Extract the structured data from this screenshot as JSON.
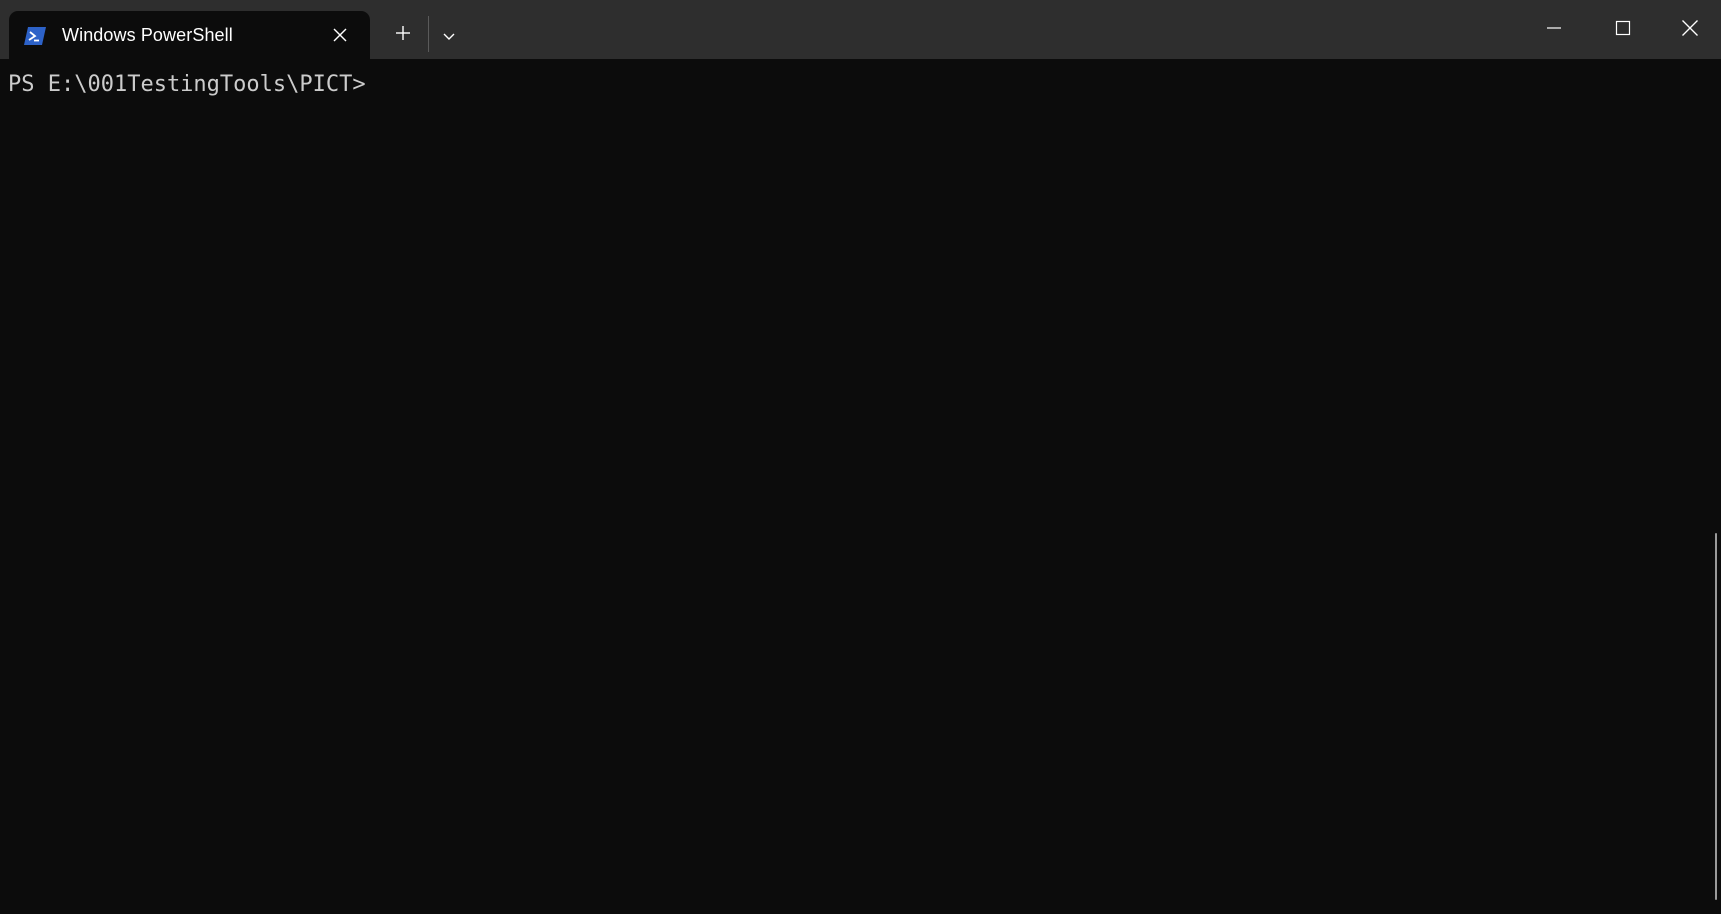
{
  "tab": {
    "title": "Windows PowerShell",
    "icon": "powershell-icon"
  },
  "toolbar": {
    "new_tab_icon": "plus-icon",
    "dropdown_icon": "chevron-down-icon"
  },
  "caption": {
    "minimize_icon": "minimize-icon",
    "maximize_icon": "maximize-icon",
    "close_icon": "close-icon"
  },
  "terminal": {
    "prompt": "PS E:\\001TestingTools\\PICT>"
  },
  "colors": {
    "titlebar": "#2e2e2e",
    "background": "#0c0c0c",
    "text": "#cccccc",
    "powershell_blue": "#2d62c8"
  }
}
